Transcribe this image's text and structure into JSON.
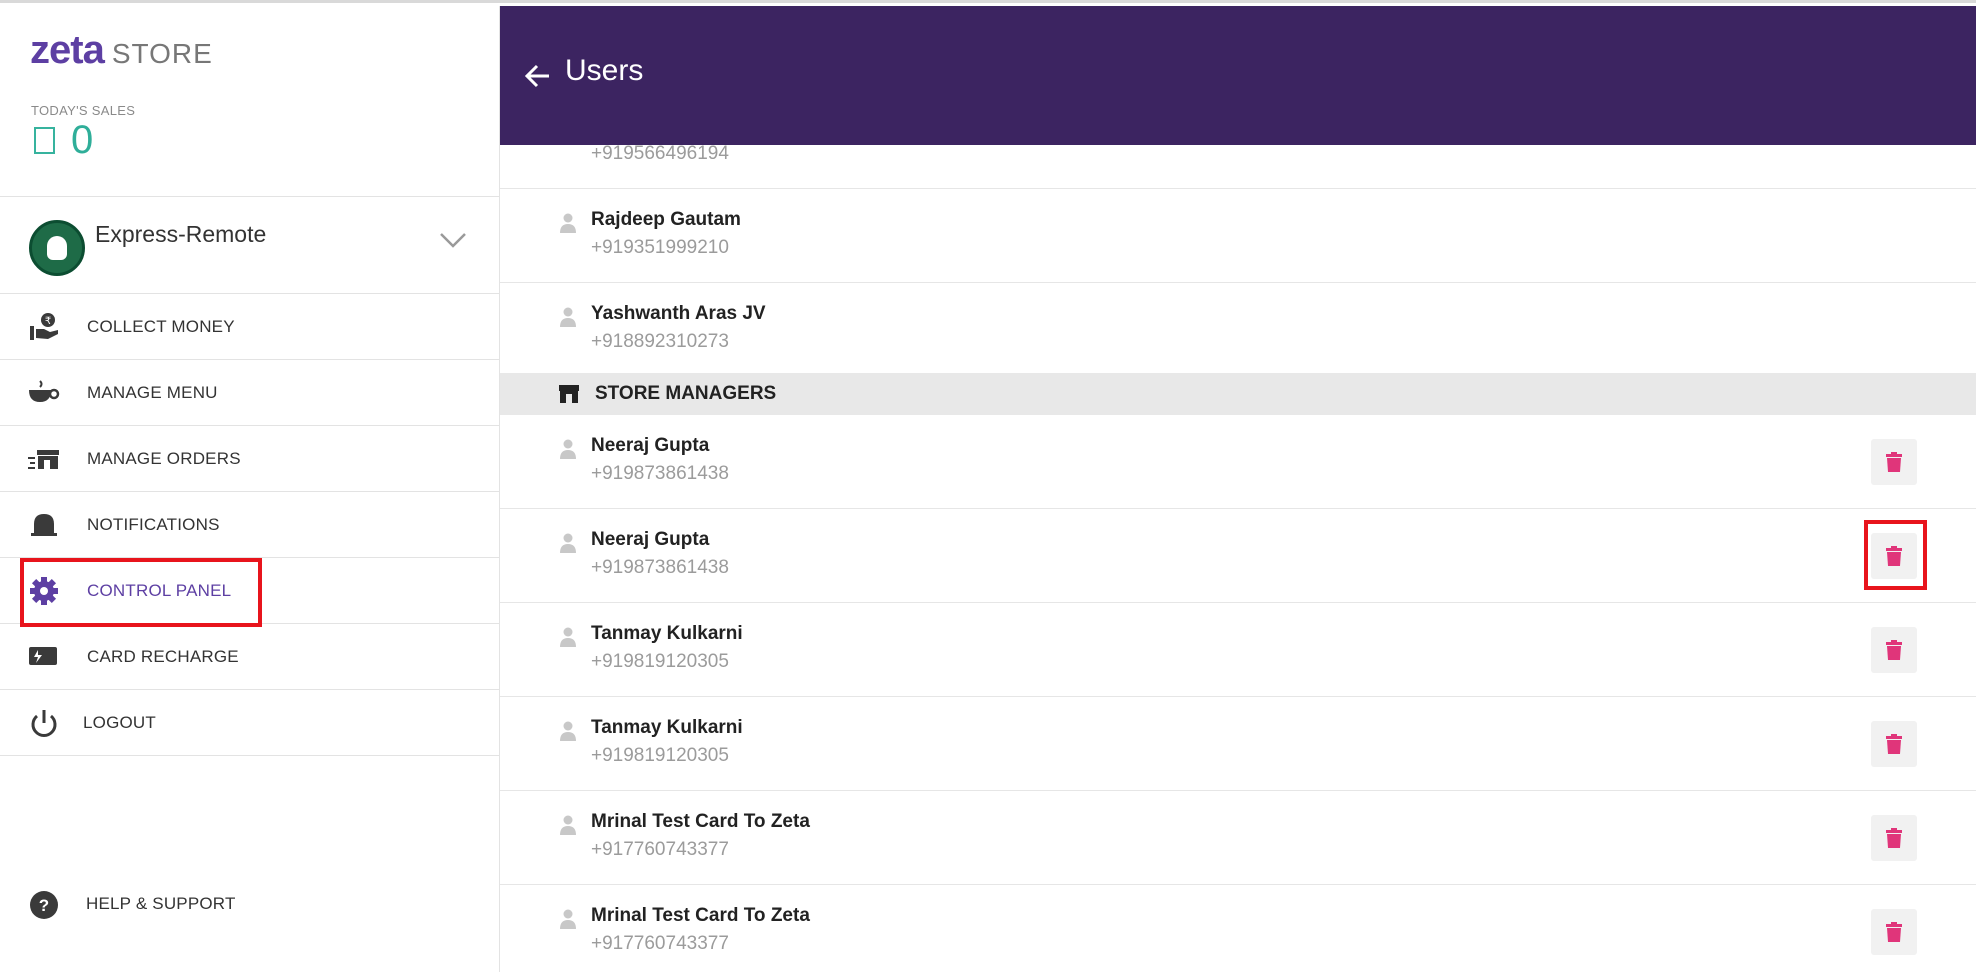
{
  "brand": {
    "logo": "zeta",
    "suffix": "STORE"
  },
  "sales": {
    "label": "TODAY'S SALES",
    "currency_icon": "rupee-icon",
    "value": "0"
  },
  "merchant": {
    "name": "Express-Remote",
    "logo_icon": "starbucks-logo-icon",
    "chevron_icon": "chevron-down-icon"
  },
  "nav": [
    {
      "label": "COLLECT MONEY",
      "icon": "hand-coin-icon"
    },
    {
      "label": "MANAGE MENU",
      "icon": "cup-icon"
    },
    {
      "label": "MANAGE ORDERS",
      "icon": "store-fast-icon"
    },
    {
      "label": "NOTIFICATIONS",
      "icon": "bell-icon"
    },
    {
      "label": "CONTROL PANEL",
      "icon": "gear-icon",
      "active": true
    },
    {
      "label": "CARD RECHARGE",
      "icon": "card-icon"
    },
    {
      "label": "LOGOUT",
      "icon": "power-icon"
    }
  ],
  "help": {
    "label": "HELP & SUPPORT",
    "icon": "question-circle-icon"
  },
  "header": {
    "title": "Users",
    "back_icon": "arrow-left-icon"
  },
  "users_top": [
    {
      "phone": "+919566496194"
    },
    {
      "name": "Rajdeep Gautam",
      "phone": "+919351999210"
    },
    {
      "name": "Yashwanth Aras JV",
      "phone": "+918892310273"
    }
  ],
  "section": {
    "label": "STORE MANAGERS",
    "icon": "store-icon"
  },
  "managers": [
    {
      "name": "Neeraj Gupta",
      "phone": "+919873861438"
    },
    {
      "name": "Neeraj Gupta",
      "phone": "+919873861438"
    },
    {
      "name": "Tanmay Kulkarni",
      "phone": "+919819120305"
    },
    {
      "name": "Tanmay Kulkarni",
      "phone": "+919819120305"
    },
    {
      "name": "Mrinal Test Card To Zeta",
      "phone": "+917760743377"
    },
    {
      "name": "Mrinal Test Card To Zeta",
      "phone": "+917760743377"
    }
  ],
  "colors": {
    "header_bg": "#3c2461",
    "accent": "#5d3fa3",
    "delete": "#e0357a",
    "highlight": "#e8141c",
    "sales": "#2fae99"
  }
}
